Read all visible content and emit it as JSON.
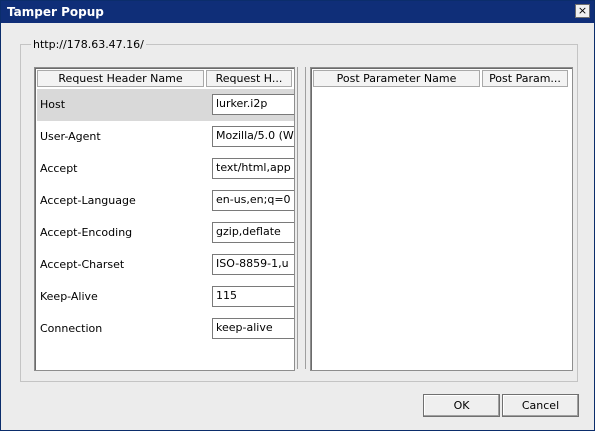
{
  "window": {
    "title": "Tamper Popup",
    "close_label": "×"
  },
  "group": {
    "url": "http://178.63.47.16/"
  },
  "headers_table": {
    "columns": [
      "Request Header Name",
      "Request H..."
    ],
    "rows": [
      {
        "name": "Host",
        "value": "lurker.i2p"
      },
      {
        "name": "User-Agent",
        "value": "Mozilla/5.0 (W"
      },
      {
        "name": "Accept",
        "value": "text/html,app"
      },
      {
        "name": "Accept-Language",
        "value": "en-us,en;q=0"
      },
      {
        "name": "Accept-Encoding",
        "value": "gzip,deflate"
      },
      {
        "name": "Accept-Charset",
        "value": "ISO-8859-1,u"
      },
      {
        "name": "Keep-Alive",
        "value": "115"
      },
      {
        "name": "Connection",
        "value": "keep-alive"
      }
    ]
  },
  "post_table": {
    "columns": [
      "Post Parameter Name",
      "Post Param..."
    ]
  },
  "buttons": {
    "ok": "OK",
    "cancel": "Cancel"
  }
}
